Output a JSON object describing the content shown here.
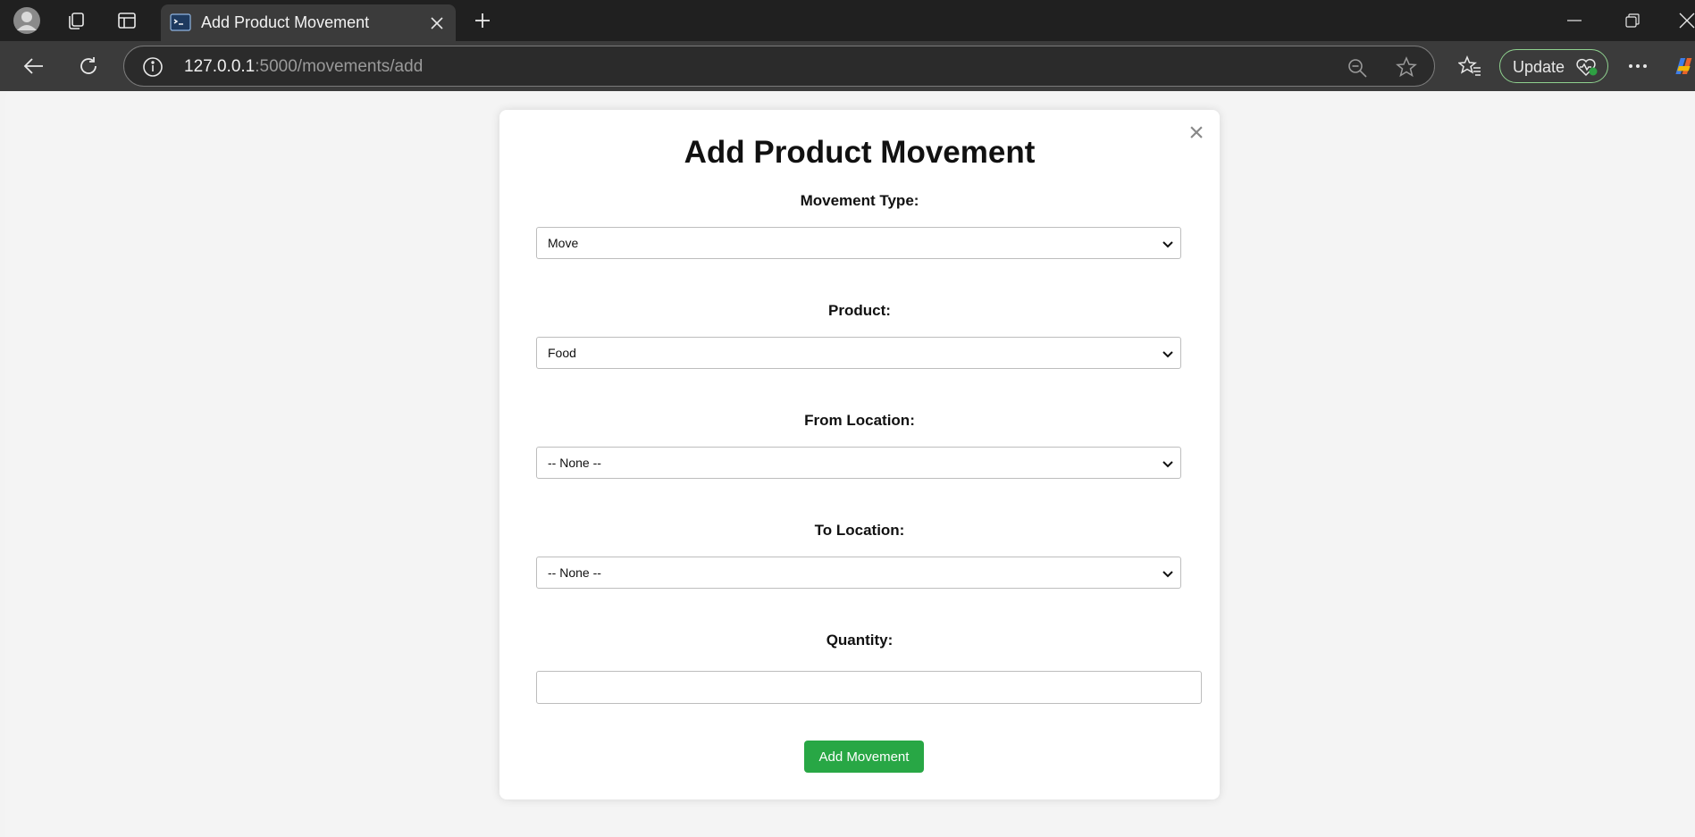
{
  "browser": {
    "tab_title": "Add Product Movement",
    "url_host": "127.0.0.1",
    "url_rest": ":5000/movements/add",
    "update_label": "Update"
  },
  "form": {
    "title": "Add Product Movement",
    "close_glyph": "×",
    "fields": [
      {
        "label": "Movement Type:",
        "value": "Move"
      },
      {
        "label": "Product:",
        "value": "Food"
      },
      {
        "label": "From Location:",
        "value": "-- None --"
      },
      {
        "label": "To Location:",
        "value": "-- None --"
      }
    ],
    "quantity_label": "Quantity:",
    "quantity_value": "",
    "submit_label": "Add Movement"
  },
  "colors": {
    "submit": "#28a745",
    "titlebar": "#202020",
    "toolbar": "#3b3b3b",
    "page_bg": "#f4f4f4"
  },
  "icons": [
    "profile-icon",
    "collections-icon",
    "tab-actions-icon",
    "terminal-favicon",
    "close-icon",
    "new-tab-icon",
    "minimize-icon",
    "restore-icon",
    "window-close-icon",
    "back-icon",
    "refresh-icon",
    "info-icon",
    "zoom-out-icon",
    "favorite-star-icon",
    "favorites-icon",
    "health-icon",
    "more-icon",
    "copilot-icon",
    "chevron-down-icon"
  ]
}
